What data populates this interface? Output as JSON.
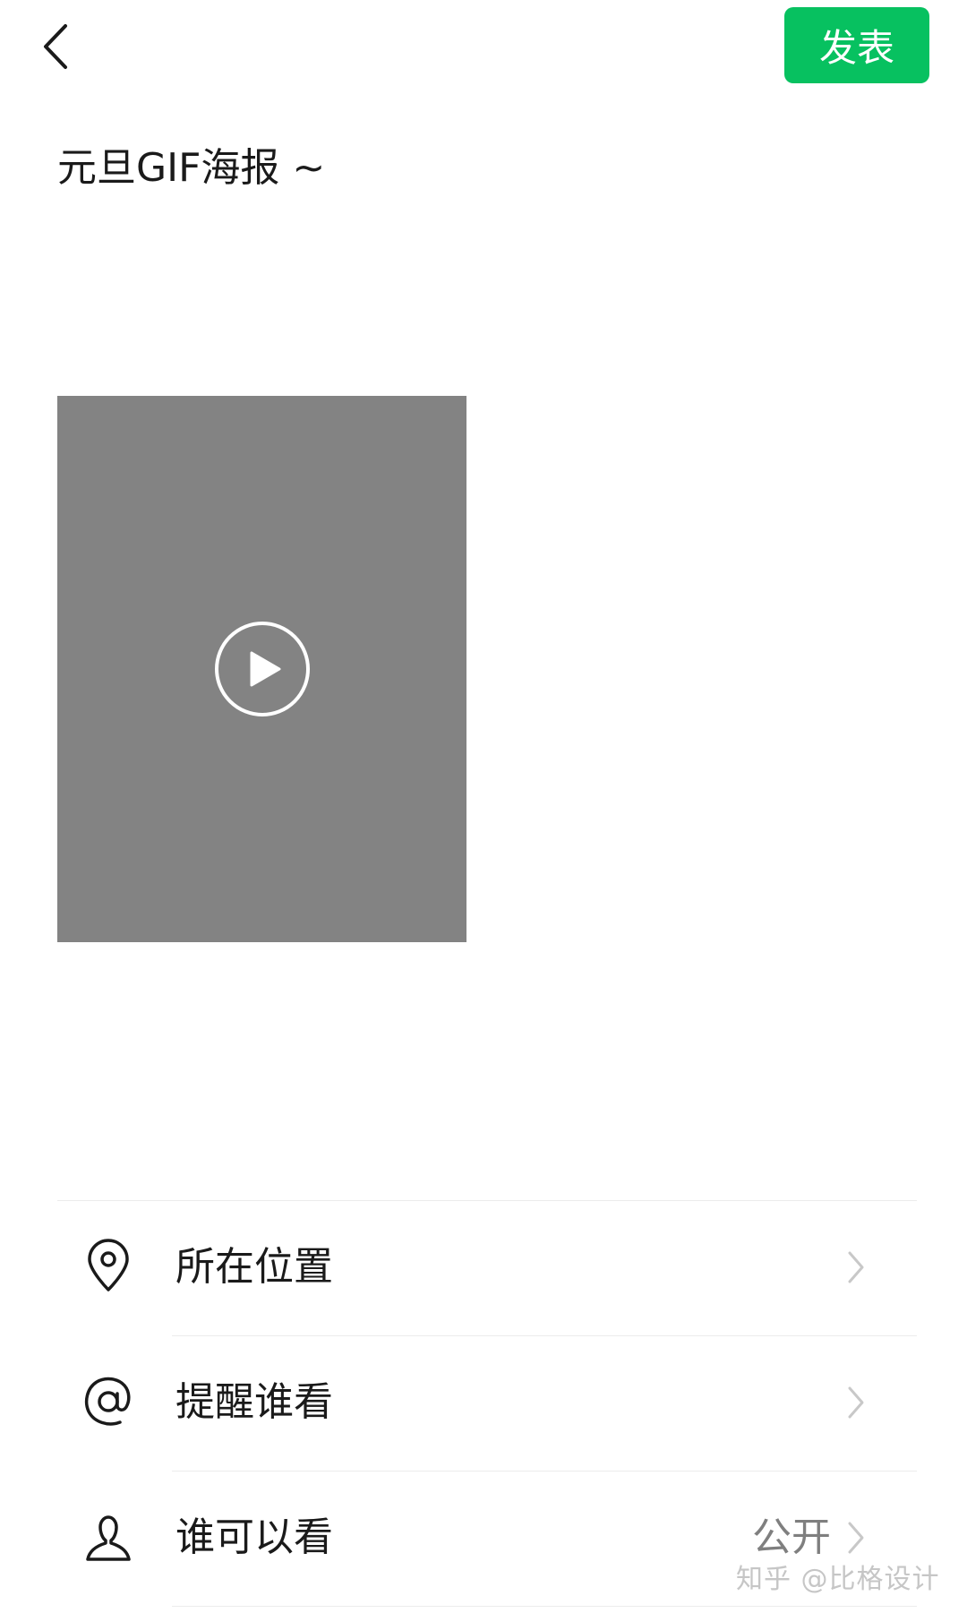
{
  "header": {
    "back_icon": "chevron-left-icon",
    "publish_label": "发表",
    "accent_color": "#07c160"
  },
  "post": {
    "caption": "元旦GIF海报 ~",
    "media": {
      "type": "video",
      "thumb_color": "#838383",
      "play_icon": "play-icon"
    }
  },
  "options": [
    {
      "icon": "location-pin-icon",
      "label": "所在位置",
      "value": ""
    },
    {
      "icon": "at-sign-icon",
      "label": "提醒谁看",
      "value": ""
    },
    {
      "icon": "person-icon",
      "label": "谁可以看",
      "value": "公开"
    }
  ],
  "watermark": "知乎 @比格设计"
}
